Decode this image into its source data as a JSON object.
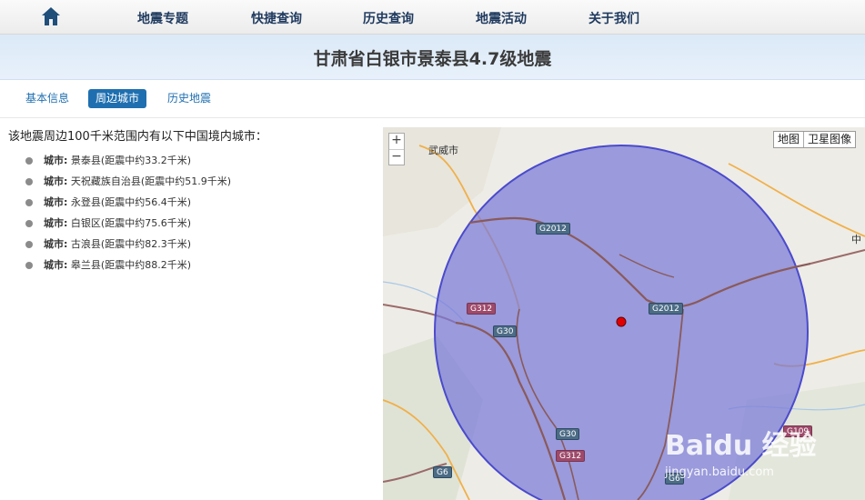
{
  "nav": {
    "items": [
      {
        "label": "地震专题"
      },
      {
        "label": "快捷查询"
      },
      {
        "label": "历史查询"
      },
      {
        "label": "地震活动"
      },
      {
        "label": "关于我们"
      }
    ]
  },
  "banner": {
    "title": "甘肃省白银市景泰县4.7级地震"
  },
  "tabs": [
    {
      "label": "基本信息",
      "active": false
    },
    {
      "label": "周边城市",
      "active": true
    },
    {
      "label": "历史地震",
      "active": false
    }
  ],
  "intro": "该地震周边100千米范围内有以下中国境内城市：",
  "city_key": "城市:",
  "cities": [
    {
      "text": "景泰县(距震中约33.2千米)"
    },
    {
      "text": "天祝藏族自治县(距震中约51.9千米)"
    },
    {
      "text": "永登县(距震中约56.4千米)"
    },
    {
      "text": "白银区(距震中约75.6千米)"
    },
    {
      "text": "古浪县(距震中约82.3千米)"
    },
    {
      "text": "皋兰县(距震中约88.2千米)"
    }
  ],
  "map": {
    "zoom_in": "+",
    "zoom_out": "−",
    "type_map": "地图",
    "type_satellite": "卫星图像",
    "place_wuwei": "武威市",
    "edge_char": "中",
    "routes": {
      "g2012": "G2012",
      "g312": "G312",
      "g30": "G30",
      "g6": "G6",
      "g109": "G109"
    },
    "watermark": "Baidu 经验",
    "watermark_url": "jingyan.baidu.com",
    "circle_color": "#7a7ad8",
    "epicenter_color": "#e00000"
  }
}
